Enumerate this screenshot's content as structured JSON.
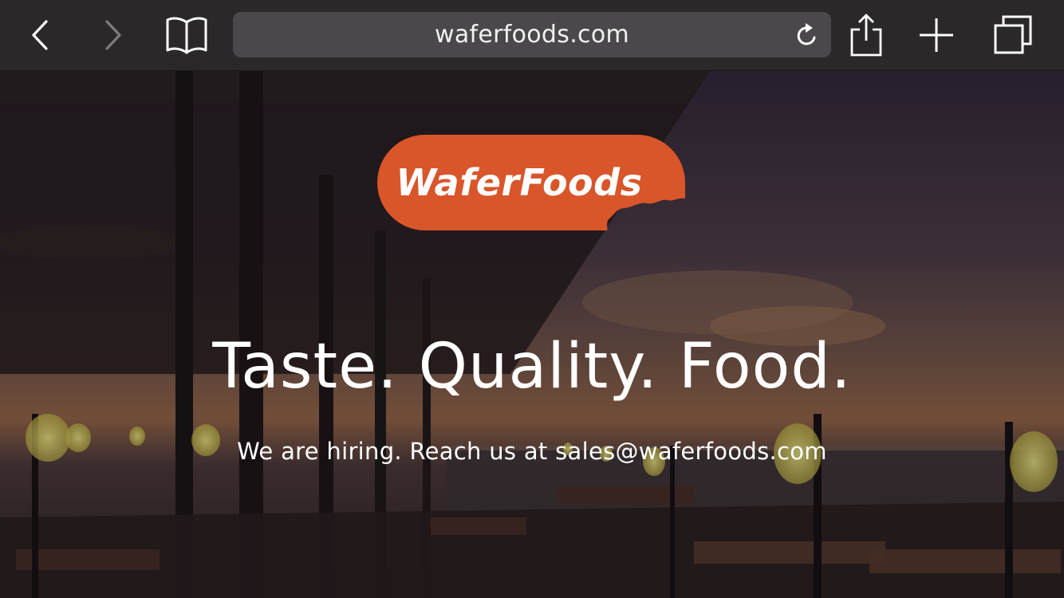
{
  "browser": {
    "url": "waferfoods.com",
    "icons": {
      "back": "chevron-left-icon",
      "forward": "chevron-right-icon",
      "bookmarks": "book-icon",
      "reload": "reload-icon",
      "share": "share-icon",
      "new_tab": "plus-icon",
      "tabs": "tabs-icon"
    }
  },
  "hero": {
    "logo_text": "WaferFoods",
    "headline": "Taste. Quality. Food.",
    "subline": "We are hiring. Reach us at sales@waferfoods.com"
  },
  "colors": {
    "toolbar": "#2a2829",
    "url_bar": "#4a484a",
    "logo_orange": "#d9552a",
    "text": "#ffffff"
  }
}
